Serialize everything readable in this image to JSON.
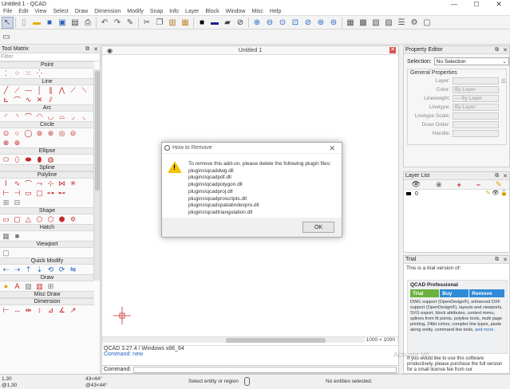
{
  "window": {
    "title": "Untitled 1 - QCAD",
    "minimize": "—",
    "maximize": "☐",
    "close": "✕"
  },
  "menu": [
    "File",
    "Edit",
    "View",
    "Select",
    "Draw",
    "Dimension",
    "Modify",
    "Snap",
    "Info",
    "Layer",
    "Block",
    "Window",
    "Misc",
    "Help"
  ],
  "tool_matrix": {
    "title": "Tool Matrix",
    "filter_placeholder": "Filter",
    "categories": [
      "Point",
      "Line",
      "Arc",
      "Circle",
      "Ellipse",
      "Spline",
      "Polyline",
      "Shape",
      "Hatch",
      "Viewport",
      "Quick Modify",
      "Draw",
      "Misc Draw",
      "Dimension"
    ]
  },
  "document": {
    "tab_title": "Untitled 1",
    "scale_label": "1000 < 1000",
    "history_line1": "QCAD 3.27.4 / Windows x86_64",
    "history_line2": "Command: new",
    "command_label": "Command:"
  },
  "dialog": {
    "title": "How to Remove",
    "message": "To remove this add-on, please delete the following plugin files:",
    "files": [
      "plugins\\qcaddwg.dll",
      "plugins\\qcadpdf.dll",
      "plugins\\qcadpolygon.dll",
      "plugins\\qcadproj.dll",
      "plugins\\qcadproscripts.dll",
      "plugins\\qcadspatialindexpro.dll",
      "plugins\\qcadtriangulation.dll"
    ],
    "ok_label": "OK"
  },
  "property_editor": {
    "title": "Property Editor",
    "selection_label": "Selection:",
    "selection_value": "No Selection",
    "group_title": "General Properties",
    "fields": [
      {
        "label": "Layer:",
        "value": ""
      },
      {
        "label": "Color:",
        "value": "By Layer"
      },
      {
        "label": "Lineweight:",
        "value": "— By Layer"
      },
      {
        "label": "Linetype:",
        "value": "By Layer"
      },
      {
        "label": "Linetype Scale:",
        "value": ""
      },
      {
        "label": "Draw Order:",
        "value": ""
      },
      {
        "label": "Handle:",
        "value": ""
      }
    ]
  },
  "layer_list": {
    "title": "Layer List",
    "layers": [
      {
        "name": "0"
      }
    ]
  },
  "trial": {
    "title": "Trial",
    "intro": "This is a trial version of:",
    "product": "QCAD Professional",
    "btn_trial": "Trial",
    "btn_buy": "Buy",
    "btn_remove": "Remove",
    "description": "DWG support (OpenDesign®), enhanced DXF support (OpenDesign®), layouts and viewports, SVG export, block attributes, context menu, splines from fit points, polyline tools, multi page printing, 24bit colors, complex line types, paste along entity, command line tools,",
    "more_link": "and more.",
    "outro": "If you would like to use this software productively, please purchase the full version for a small license fee from our"
  },
  "statusbar": {
    "coord_abs": "1,30",
    "coord_rel": "@1,30",
    "coord_polar1": "43<44°",
    "coord_polar2": "@43<44°",
    "prompt": "Select entity or region",
    "selected": "No entities selected."
  },
  "watermark": "Activate Wi"
}
